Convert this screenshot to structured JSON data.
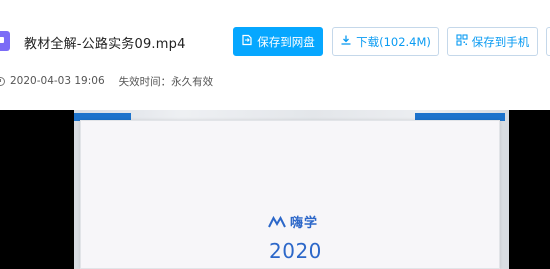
{
  "file": {
    "name": "教材全解-公路实务09.mp4",
    "upload_time": "2020-04-03 19:06",
    "expire_label": "失效时间：永久有效"
  },
  "actions": {
    "save_label": "保存到网盘",
    "download_label": "下载(102.4M)",
    "phone_label": "保存到手机"
  },
  "video": {
    "brand_text": "嗨学",
    "year_text": "2020"
  },
  "colors": {
    "primary": "#06a7ff",
    "link": "#0a9bf2",
    "file_icon": "#7b6cf6",
    "brand": "#2c67c9"
  }
}
